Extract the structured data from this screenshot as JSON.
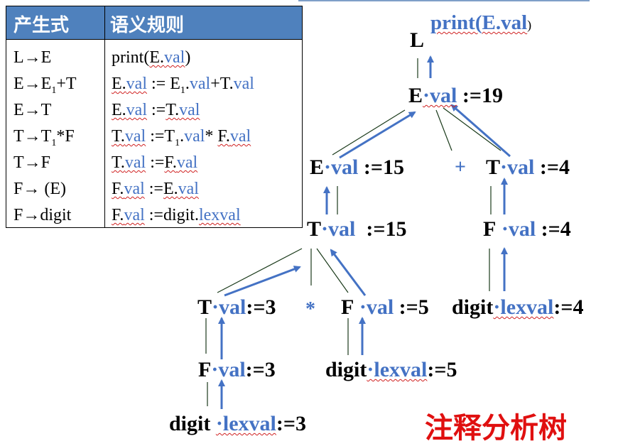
{
  "table": {
    "headers": [
      "产生式",
      "语义规则"
    ],
    "rows": [
      {
        "prod": "L→E",
        "rule": "print(E.val)"
      },
      {
        "prod": "E→E1+T",
        "rule": "E.val := E1.val+T.val"
      },
      {
        "prod": "E→T",
        "rule": "E.val :=T.val"
      },
      {
        "prod": "T→T1*F",
        "rule": "T.val :=T1.val* F.val"
      },
      {
        "prod": "T→F",
        "rule": "T.val :=F.val"
      },
      {
        "prod": "F→ (E)",
        "rule": "F.val :=E.val"
      },
      {
        "prod": "F→digit",
        "rule": "F.val :=digit.lexval"
      }
    ]
  },
  "tree": {
    "root": {
      "sym": "L",
      "action": "print(E.val",
      "close": ")"
    },
    "e_root": {
      "sym": "E",
      "attr": "·val",
      "value": ":=19"
    },
    "e_left": {
      "sym": "E",
      "attr": "·val",
      "value": ":=15"
    },
    "plus": "+",
    "t_right": {
      "sym": "T",
      "attr": "·val",
      "value": ":=4"
    },
    "t_mid": {
      "sym": "T",
      "attr": "·val",
      "value": ":=15"
    },
    "f_right": {
      "sym": "F",
      "attr": "·val",
      "value": ":=4"
    },
    "t_low": {
      "sym": "T",
      "attr": "·val",
      "value": ":=3"
    },
    "times": "*",
    "f_mid": {
      "sym": "F",
      "attr": "·val",
      "value": ":=5"
    },
    "digit_right": {
      "sym": "digit",
      "attr": "·lexval",
      "value": ":=4"
    },
    "f_low": {
      "sym": "F",
      "attr": "·val",
      "value": ":=3"
    },
    "digit_mid": {
      "sym": "digit",
      "attr": "·lexval",
      "value": ":=5"
    },
    "digit_low": {
      "sym": "digit",
      "attr": "·lexval",
      "value": ":=3"
    }
  },
  "caption": "注释分析树",
  "colors": {
    "header": "#4f81bd",
    "accent": "#4472c4",
    "caption": "#e01010"
  }
}
